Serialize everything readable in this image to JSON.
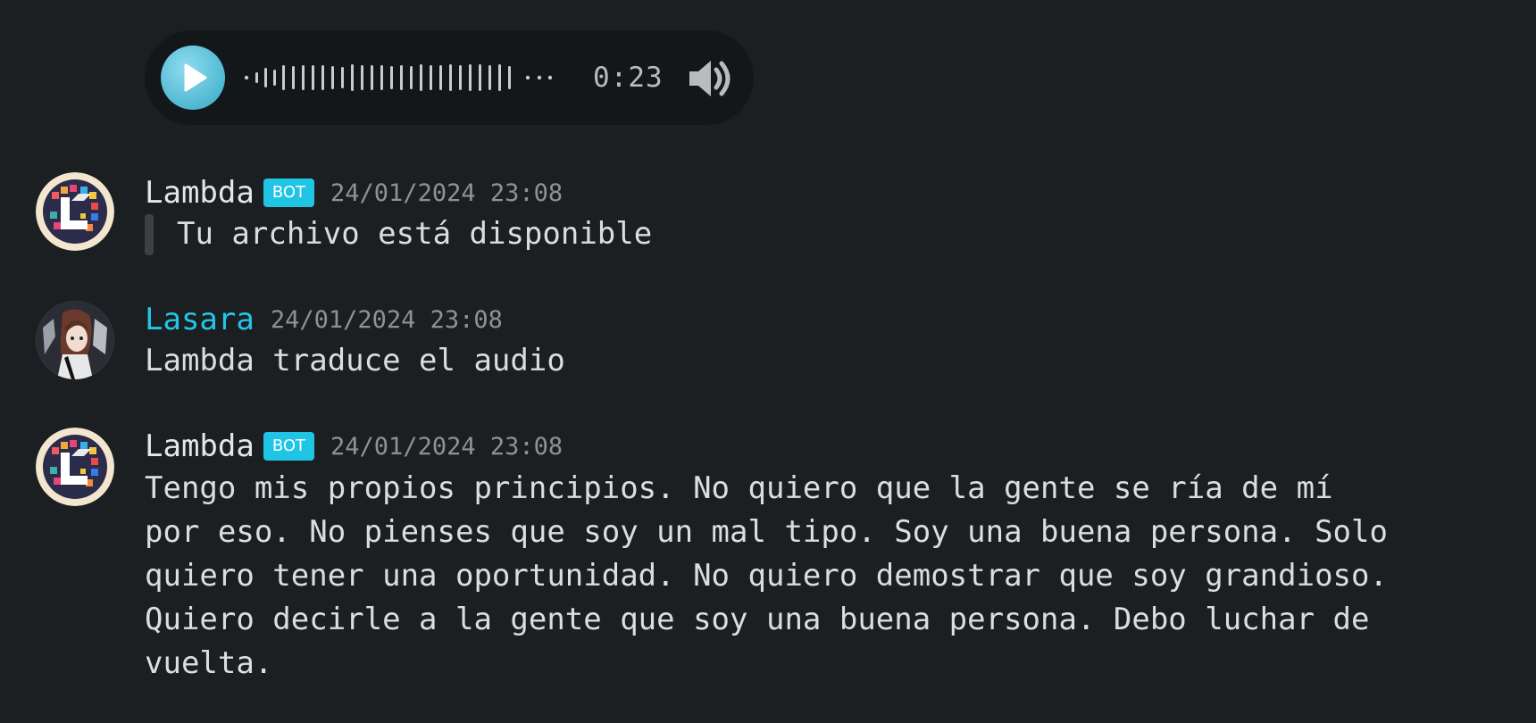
{
  "audio": {
    "duration": "0:23"
  },
  "messages": [
    {
      "author": "Lambda",
      "bot_tag": "BOT",
      "timestamp": "24/01/2024 23:08",
      "quote": "Tu archivo está disponible"
    },
    {
      "author": "Lasara",
      "timestamp": "24/01/2024 23:08",
      "text": "Lambda traduce el audio"
    },
    {
      "author": "Lambda",
      "bot_tag": "BOT",
      "timestamp": "24/01/2024 23:08",
      "lines": [
        "Tengo mis propios principios. No quiero que la gente se ría de mí",
        "por eso. No pienses que soy un mal tipo. Soy una buena persona. Solo",
        "quiero tener una oportunidad. No quiero demostrar que soy grandioso.",
        "Quiero decirle a la gente que soy una buena persona. Debo luchar de",
        "vuelta."
      ]
    }
  ],
  "colors": {
    "background": "#1c1f21",
    "accent": "#22c6e8",
    "bot_tag": "#20c4e4",
    "timestamp": "#8e9297"
  },
  "icons": {
    "play": "play-icon",
    "volume": "volume-icon"
  }
}
